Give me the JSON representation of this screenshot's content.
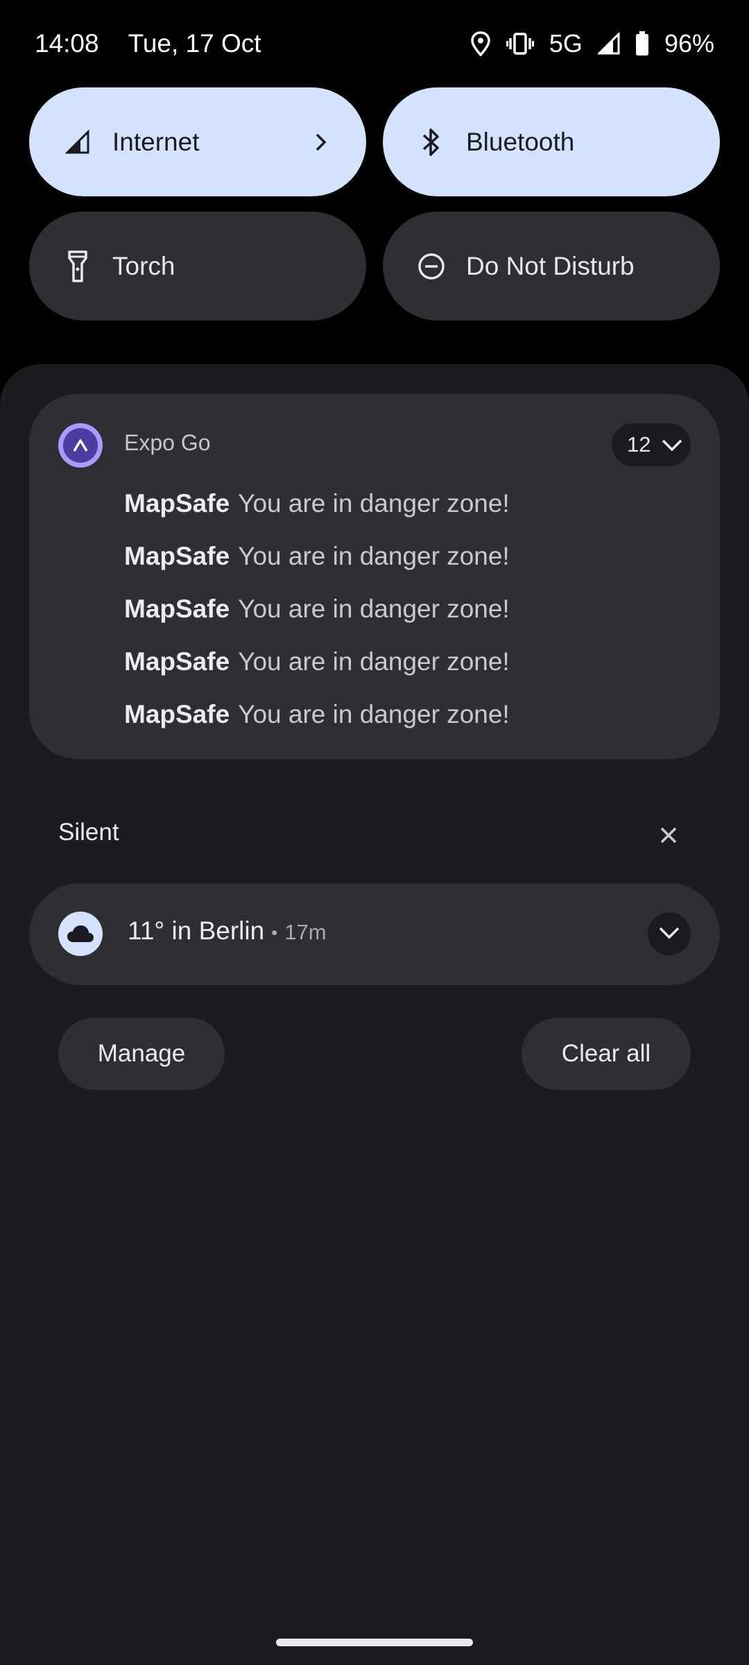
{
  "status_bar": {
    "time": "14:08",
    "date": "Tue, 17 Oct",
    "network": "5G",
    "battery": "96%",
    "icons": [
      "location-icon",
      "vibrate-icon",
      "signal-icon",
      "battery-icon"
    ]
  },
  "quick_settings": {
    "tiles": [
      {
        "label": "Internet",
        "icon": "signal-icon",
        "active": true
      },
      {
        "label": "Bluetooth",
        "icon": "bluetooth-icon",
        "active": true
      },
      {
        "label": "Torch",
        "icon": "torch-icon",
        "active": false
      },
      {
        "label": "Do Not Disturb",
        "icon": "do-not-disturb-icon",
        "active": false
      }
    ]
  },
  "notification_group": {
    "app_name": "Expo Go",
    "count": "12",
    "messages": [
      {
        "title": "MapSafe",
        "text": "You are in danger zone!"
      },
      {
        "title": "MapSafe",
        "text": "You are in danger zone!"
      },
      {
        "title": "MapSafe",
        "text": "You are in danger zone!"
      },
      {
        "title": "MapSafe",
        "text": "You are in danger zone!"
      },
      {
        "title": "MapSafe",
        "text": "You are in danger zone!"
      }
    ]
  },
  "silent_section": {
    "title": "Silent",
    "weather": {
      "text": "11° in Berlin",
      "separator": "•",
      "time": "17m"
    }
  },
  "actions": {
    "manage": "Manage",
    "clear_all": "Clear all"
  },
  "colors": {
    "active_tile": "#d3e3fd",
    "inactive_tile": "#2e2f33",
    "shade_background": "#1c1c20",
    "app_accent": "#a79bff"
  }
}
